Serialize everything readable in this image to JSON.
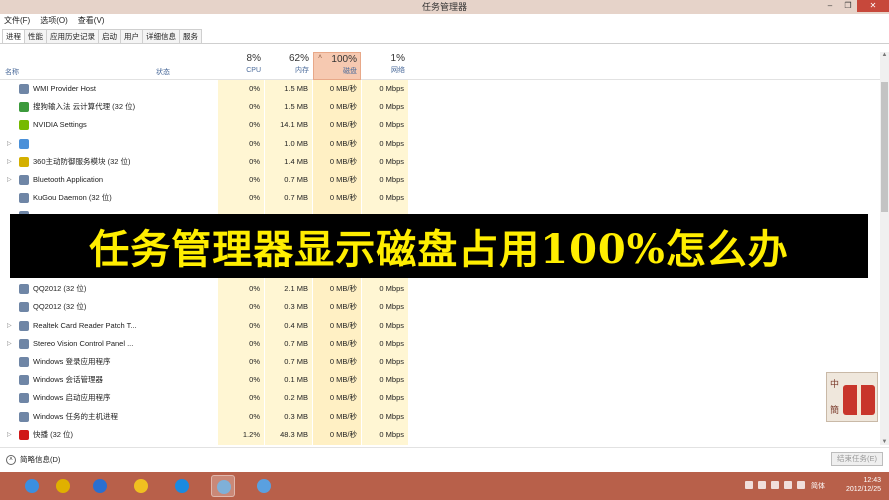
{
  "window": {
    "title": "任务管理器",
    "minimize": "–",
    "maximize": "❐",
    "close": "✕"
  },
  "menu": [
    "文件(F)",
    "选项(O)",
    "查看(V)"
  ],
  "tabs": [
    "进程",
    "性能",
    "应用历史记录",
    "启动",
    "用户",
    "详细信息",
    "服务"
  ],
  "columns": {
    "name": "名称",
    "status": "状态",
    "cpu": {
      "pct": "8%",
      "label": "CPU"
    },
    "memory": {
      "pct": "62%",
      "label": "内存"
    },
    "disk": {
      "pct": "100%",
      "label": "磁盘"
    },
    "network": {
      "pct": "1%",
      "label": "网络"
    }
  },
  "processes": [
    {
      "name": "WMI Provider Host",
      "expand": "",
      "cpu": "0%",
      "mem": "1.5 MB",
      "disk": "0 MB/秒",
      "net": "0 Mbps",
      "icon_color": "#6f86a6"
    },
    {
      "name": "搜狗输入法 云计算代理 (32 位)",
      "expand": "",
      "cpu": "0%",
      "mem": "1.5 MB",
      "disk": "0 MB/秒",
      "net": "0 Mbps",
      "icon_color": "#3c9a3c"
    },
    {
      "name": "NVIDIA Settings",
      "expand": "",
      "cpu": "0%",
      "mem": "14.1 MB",
      "disk": "0 MB/秒",
      "net": "0 Mbps",
      "icon_color": "#76b900"
    },
    {
      "name": "",
      "expand": "▷",
      "cpu": "0%",
      "mem": "1.0 MB",
      "disk": "0 MB/秒",
      "net": "0 Mbps",
      "icon_color": "#4a90d9"
    },
    {
      "name": "360主动防御服务模块 (32 位)",
      "expand": "▷",
      "cpu": "0%",
      "mem": "1.4 MB",
      "disk": "0 MB/秒",
      "net": "0 Mbps",
      "icon_color": "#d4b000"
    },
    {
      "name": "Bluetooth Application",
      "expand": "▷",
      "cpu": "0%",
      "mem": "0.7 MB",
      "disk": "0 MB/秒",
      "net": "0 Mbps",
      "icon_color": "#6f86a6"
    },
    {
      "name": "KuGou Daemon (32 位)",
      "expand": "",
      "cpu": "0%",
      "mem": "0.7 MB",
      "disk": "0 MB/秒",
      "net": "0 Mbps",
      "icon_color": "#6f86a6"
    },
    {
      "name": "",
      "expand": "",
      "cpu": "",
      "mem": "",
      "disk": "",
      "net": "",
      "icon_color": "#6f86a6"
    },
    {
      "name": "",
      "expand": "",
      "cpu": "",
      "mem": "",
      "disk": "",
      "net": "",
      "icon_color": "#6f86a6"
    },
    {
      "name": "",
      "expand": "",
      "cpu": "",
      "mem": "",
      "disk": "",
      "net": "",
      "icon_color": "#6f86a6"
    },
    {
      "name": "",
      "expand": "",
      "cpu": "",
      "mem": "",
      "disk": "",
      "net": "",
      "icon_color": "#6f86a6"
    },
    {
      "name": "QQ2012 (32 位)",
      "expand": "",
      "cpu": "0%",
      "mem": "2.1 MB",
      "disk": "0 MB/秒",
      "net": "0 Mbps",
      "icon_color": "#6f86a6"
    },
    {
      "name": "QQ2012 (32 位)",
      "expand": "",
      "cpu": "0%",
      "mem": "0.3 MB",
      "disk": "0 MB/秒",
      "net": "0 Mbps",
      "icon_color": "#6f86a6"
    },
    {
      "name": "Realtek Card Reader Patch T...",
      "expand": "▷",
      "cpu": "0%",
      "mem": "0.4 MB",
      "disk": "0 MB/秒",
      "net": "0 Mbps",
      "icon_color": "#6f86a6"
    },
    {
      "name": "Stereo Vision Control Panel ...",
      "expand": "▷",
      "cpu": "0%",
      "mem": "0.7 MB",
      "disk": "0 MB/秒",
      "net": "0 Mbps",
      "icon_color": "#6f86a6"
    },
    {
      "name": "Windows 登录应用程序",
      "expand": "",
      "cpu": "0%",
      "mem": "0.7 MB",
      "disk": "0 MB/秒",
      "net": "0 Mbps",
      "icon_color": "#6f86a6"
    },
    {
      "name": "Windows 会话管理器",
      "expand": "",
      "cpu": "0%",
      "mem": "0.1 MB",
      "disk": "0 MB/秒",
      "net": "0 Mbps",
      "icon_color": "#6f86a6"
    },
    {
      "name": "Windows 启动应用程序",
      "expand": "",
      "cpu": "0%",
      "mem": "0.2 MB",
      "disk": "0 MB/秒",
      "net": "0 Mbps",
      "icon_color": "#6f86a6"
    },
    {
      "name": "Windows 任务的主机进程",
      "expand": "",
      "cpu": "0%",
      "mem": "0.3 MB",
      "disk": "0 MB/秒",
      "net": "0 Mbps",
      "icon_color": "#6f86a6"
    },
    {
      "name": "快播 (32 位)",
      "expand": "▷",
      "cpu": "1.2%",
      "mem": "48.3 MB",
      "disk": "0 MB/秒",
      "net": "0 Mbps",
      "icon_color": "#d01818"
    }
  ],
  "banner": "任务管理器显示磁盘占用100%怎么办",
  "footer": {
    "fewer_details": "简略信息(D)",
    "end_task": "结束任务(E)"
  },
  "taskbar": {
    "apps": [
      {
        "name": "ie-icon",
        "color": "#3b8fe0"
      },
      {
        "name": "chrome-icon",
        "color": "#e0b000"
      },
      {
        "name": "sogou-icon",
        "color": "#2a6fd0"
      },
      {
        "name": "notes-icon",
        "color": "#f0c020"
      },
      {
        "name": "kugou-icon",
        "color": "#1a8ae0"
      },
      {
        "name": "task-manager-icon",
        "color": "#7fb0d8"
      },
      {
        "name": "network-app-icon",
        "color": "#5aa0e0"
      }
    ],
    "lang": "简体",
    "time": "12:43",
    "date": "2012/12/25"
  },
  "watermark": {
    "zhong": "中",
    "jian": "簡"
  },
  "colors": {
    "disk_header": "#f6c9b1",
    "data_column": "#fff6d3",
    "taskbar": "#b8604a",
    "banner_text": "#ffee00"
  }
}
